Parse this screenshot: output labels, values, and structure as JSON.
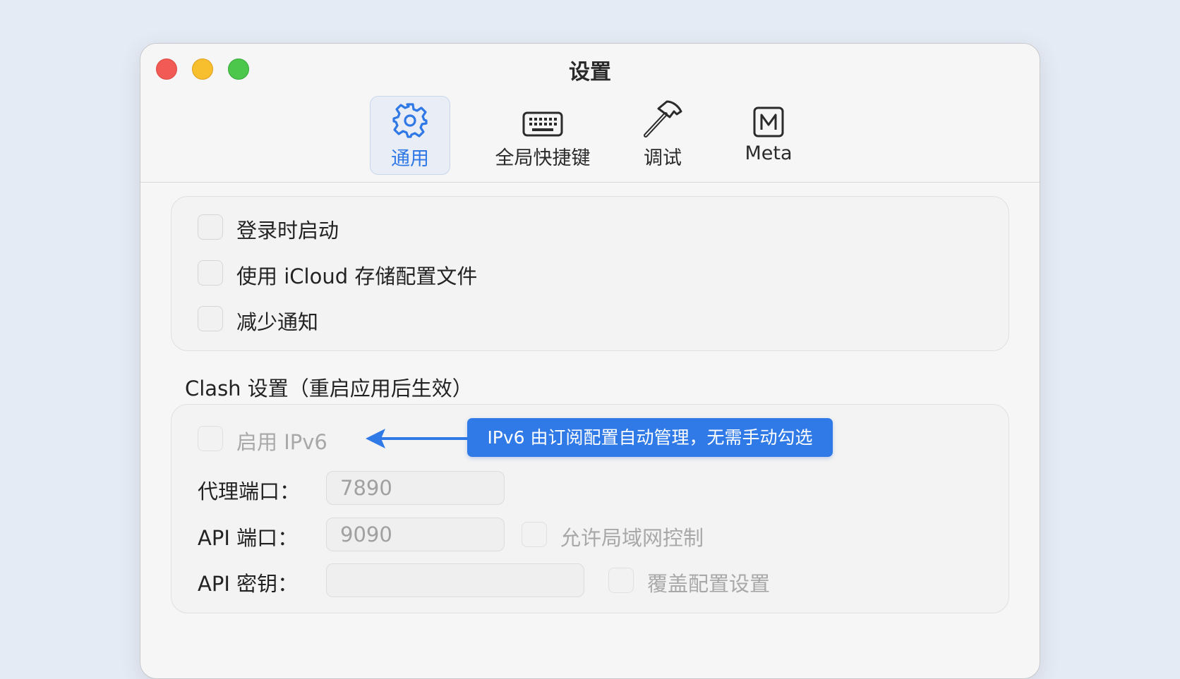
{
  "window": {
    "title": "设置"
  },
  "tabs": [
    {
      "label": "通用",
      "icon": "gear-icon",
      "active": true
    },
    {
      "label": "全局快捷键",
      "icon": "keyboard-icon",
      "active": false
    },
    {
      "label": "调试",
      "icon": "hammer-icon",
      "active": false
    },
    {
      "label": "Meta",
      "icon": "meta-m-icon",
      "active": false
    }
  ],
  "general": {
    "launch_at_login": {
      "label": "登录时启动",
      "checked": false
    },
    "icloud_config": {
      "label": "使用 iCloud 存储配置文件",
      "checked": false
    },
    "reduce_notifications": {
      "label": "减少通知",
      "checked": false
    }
  },
  "clash": {
    "section_title": "Clash 设置（重启应用后生效）",
    "ipv6": {
      "label": "启用 IPv6",
      "checked": false,
      "disabled": true
    },
    "proxy_port": {
      "label": "代理端口：",
      "value": "7890"
    },
    "api_port": {
      "label": "API 端口：",
      "value": "9090"
    },
    "allow_lan": {
      "label": "允许局域网控制",
      "checked": false
    },
    "api_secret": {
      "label": "API 密钥：",
      "value": ""
    },
    "override_config": {
      "label": "覆盖配置设置",
      "checked": false
    }
  },
  "annotation": {
    "text": "IPv6 由订阅配置自动管理，无需手动勾选"
  },
  "colors": {
    "accent": "#2f7ae6",
    "background": "#e5ebf4",
    "window": "#f6f6f6"
  }
}
